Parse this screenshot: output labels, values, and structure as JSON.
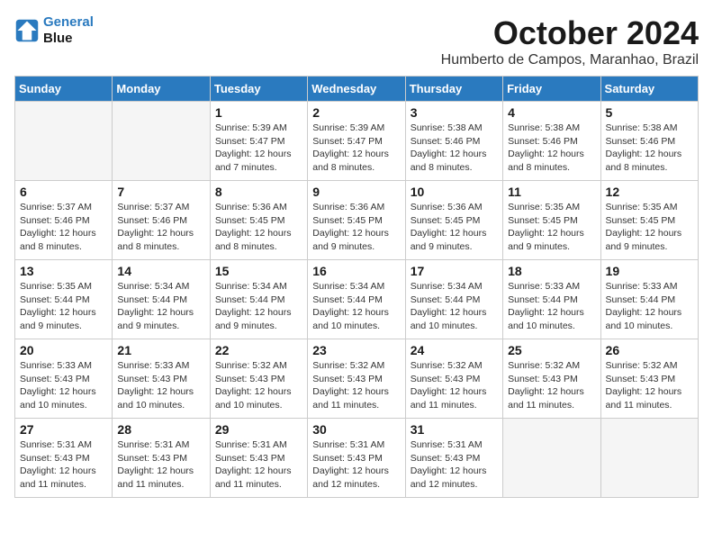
{
  "logo": {
    "line1": "General",
    "line2": "Blue"
  },
  "header": {
    "month": "October 2024",
    "location": "Humberto de Campos, Maranhao, Brazil"
  },
  "weekdays": [
    "Sunday",
    "Monday",
    "Tuesday",
    "Wednesday",
    "Thursday",
    "Friday",
    "Saturday"
  ],
  "weeks": [
    [
      {
        "day": "",
        "info": ""
      },
      {
        "day": "",
        "info": ""
      },
      {
        "day": "1",
        "info": "Sunrise: 5:39 AM\nSunset: 5:47 PM\nDaylight: 12 hours\nand 7 minutes."
      },
      {
        "day": "2",
        "info": "Sunrise: 5:39 AM\nSunset: 5:47 PM\nDaylight: 12 hours\nand 8 minutes."
      },
      {
        "day": "3",
        "info": "Sunrise: 5:38 AM\nSunset: 5:46 PM\nDaylight: 12 hours\nand 8 minutes."
      },
      {
        "day": "4",
        "info": "Sunrise: 5:38 AM\nSunset: 5:46 PM\nDaylight: 12 hours\nand 8 minutes."
      },
      {
        "day": "5",
        "info": "Sunrise: 5:38 AM\nSunset: 5:46 PM\nDaylight: 12 hours\nand 8 minutes."
      }
    ],
    [
      {
        "day": "6",
        "info": "Sunrise: 5:37 AM\nSunset: 5:46 PM\nDaylight: 12 hours\nand 8 minutes."
      },
      {
        "day": "7",
        "info": "Sunrise: 5:37 AM\nSunset: 5:46 PM\nDaylight: 12 hours\nand 8 minutes."
      },
      {
        "day": "8",
        "info": "Sunrise: 5:36 AM\nSunset: 5:45 PM\nDaylight: 12 hours\nand 8 minutes."
      },
      {
        "day": "9",
        "info": "Sunrise: 5:36 AM\nSunset: 5:45 PM\nDaylight: 12 hours\nand 9 minutes."
      },
      {
        "day": "10",
        "info": "Sunrise: 5:36 AM\nSunset: 5:45 PM\nDaylight: 12 hours\nand 9 minutes."
      },
      {
        "day": "11",
        "info": "Sunrise: 5:35 AM\nSunset: 5:45 PM\nDaylight: 12 hours\nand 9 minutes."
      },
      {
        "day": "12",
        "info": "Sunrise: 5:35 AM\nSunset: 5:45 PM\nDaylight: 12 hours\nand 9 minutes."
      }
    ],
    [
      {
        "day": "13",
        "info": "Sunrise: 5:35 AM\nSunset: 5:44 PM\nDaylight: 12 hours\nand 9 minutes."
      },
      {
        "day": "14",
        "info": "Sunrise: 5:34 AM\nSunset: 5:44 PM\nDaylight: 12 hours\nand 9 minutes."
      },
      {
        "day": "15",
        "info": "Sunrise: 5:34 AM\nSunset: 5:44 PM\nDaylight: 12 hours\nand 9 minutes."
      },
      {
        "day": "16",
        "info": "Sunrise: 5:34 AM\nSunset: 5:44 PM\nDaylight: 12 hours\nand 10 minutes."
      },
      {
        "day": "17",
        "info": "Sunrise: 5:34 AM\nSunset: 5:44 PM\nDaylight: 12 hours\nand 10 minutes."
      },
      {
        "day": "18",
        "info": "Sunrise: 5:33 AM\nSunset: 5:44 PM\nDaylight: 12 hours\nand 10 minutes."
      },
      {
        "day": "19",
        "info": "Sunrise: 5:33 AM\nSunset: 5:44 PM\nDaylight: 12 hours\nand 10 minutes."
      }
    ],
    [
      {
        "day": "20",
        "info": "Sunrise: 5:33 AM\nSunset: 5:43 PM\nDaylight: 12 hours\nand 10 minutes."
      },
      {
        "day": "21",
        "info": "Sunrise: 5:33 AM\nSunset: 5:43 PM\nDaylight: 12 hours\nand 10 minutes."
      },
      {
        "day": "22",
        "info": "Sunrise: 5:32 AM\nSunset: 5:43 PM\nDaylight: 12 hours\nand 10 minutes."
      },
      {
        "day": "23",
        "info": "Sunrise: 5:32 AM\nSunset: 5:43 PM\nDaylight: 12 hours\nand 11 minutes."
      },
      {
        "day": "24",
        "info": "Sunrise: 5:32 AM\nSunset: 5:43 PM\nDaylight: 12 hours\nand 11 minutes."
      },
      {
        "day": "25",
        "info": "Sunrise: 5:32 AM\nSunset: 5:43 PM\nDaylight: 12 hours\nand 11 minutes."
      },
      {
        "day": "26",
        "info": "Sunrise: 5:32 AM\nSunset: 5:43 PM\nDaylight: 12 hours\nand 11 minutes."
      }
    ],
    [
      {
        "day": "27",
        "info": "Sunrise: 5:31 AM\nSunset: 5:43 PM\nDaylight: 12 hours\nand 11 minutes."
      },
      {
        "day": "28",
        "info": "Sunrise: 5:31 AM\nSunset: 5:43 PM\nDaylight: 12 hours\nand 11 minutes."
      },
      {
        "day": "29",
        "info": "Sunrise: 5:31 AM\nSunset: 5:43 PM\nDaylight: 12 hours\nand 11 minutes."
      },
      {
        "day": "30",
        "info": "Sunrise: 5:31 AM\nSunset: 5:43 PM\nDaylight: 12 hours\nand 12 minutes."
      },
      {
        "day": "31",
        "info": "Sunrise: 5:31 AM\nSunset: 5:43 PM\nDaylight: 12 hours\nand 12 minutes."
      },
      {
        "day": "",
        "info": ""
      },
      {
        "day": "",
        "info": ""
      }
    ]
  ]
}
